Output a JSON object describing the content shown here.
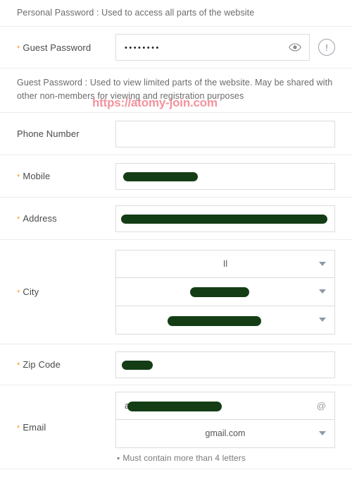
{
  "theme": {
    "required_asterisk_color": "#f59a23",
    "border_color": "#dcdcdc",
    "divider_color": "#ededed",
    "redaction_color": "#143d16",
    "watermark_color": "#f3808c",
    "text_color": "#555555"
  },
  "watermark": {
    "text": "https://atomy-join.com"
  },
  "notes": {
    "personal_password": "Personal Password : Used to access all parts of the website",
    "guest_password": "Guest Password : Used to view limited parts of the website. May be shared with other non-members for viewing and registration purposes"
  },
  "fields": {
    "guest_password": {
      "label": "Guest Password",
      "required_marker": "*",
      "value": "••••••••",
      "placeholder": "",
      "toggle_icon": "eye-icon",
      "warning_icon": "!"
    },
    "phone_number": {
      "label": "Phone Number",
      "required_marker": "",
      "value": "",
      "placeholder": ""
    },
    "mobile": {
      "label": "Mobile",
      "required_marker": "*",
      "value": "",
      "placeholder": "",
      "redacted": true
    },
    "address": {
      "label": "Address",
      "required_marker": "*",
      "value": "",
      "placeholder": "",
      "redacted": true
    },
    "city": {
      "label": "City",
      "required_marker": "*",
      "state_value": "Il",
      "city_value": "",
      "district_value": "",
      "caret_icon": "chevron-down-icon"
    },
    "zip_code": {
      "label": "Zip Code",
      "required_marker": "*",
      "value": "",
      "placeholder": "",
      "redacted": true
    },
    "email": {
      "label": "Email",
      "required_marker": "*",
      "local_part": "a",
      "at_symbol": "@",
      "domain_value": "gmail.com",
      "caret_icon": "chevron-down-icon",
      "hint_bullet": "▪",
      "hint": "Must contain more than 4 letters"
    }
  }
}
